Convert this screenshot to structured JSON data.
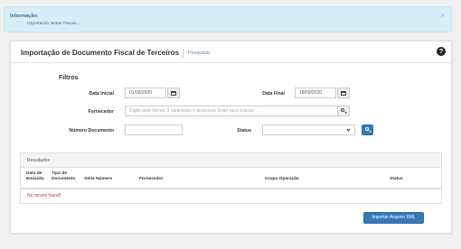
{
  "alert": {
    "title": "Informação:",
    "message": "Importando Notas Fiscais...",
    "close": "×"
  },
  "header": {
    "title": "Importação de Documento Fiscal de Terceiros",
    "subtitle_link": "Pesquisar",
    "help": "?"
  },
  "filters": {
    "heading": "Filtros",
    "data_inicial_label": "Data Inicial",
    "data_inicial_value": "01/03/2020",
    "data_final_label": "Data Final",
    "data_final_value": "18/03/2020",
    "fornecedor_label": "Fornecedor",
    "fornecedor_placeholder": "Digite pelo menos 3 caracteres e pressione Enter para buscar...",
    "numero_documento_label": "Número Documento",
    "numero_documento_value": "",
    "status_label": "Status",
    "status_value": ""
  },
  "results": {
    "title": "Resultados",
    "columns": [
      "Data de Emissão",
      "Tipo de Documento",
      "Série Número",
      "Fornecedor",
      "Grupo Operação",
      "Status"
    ],
    "empty_message": "No record found!"
  },
  "actions": {
    "import_label": "Importar Arquivo XML"
  },
  "colors": {
    "primary": "#337ab7",
    "alert_bg": "#d9edf7",
    "alert_text": "#31708f",
    "empty_text": "#c0392b"
  },
  "icons": [
    "close-icon",
    "help-icon",
    "calendar-icon",
    "search-icon",
    "chevron-down-icon"
  ]
}
